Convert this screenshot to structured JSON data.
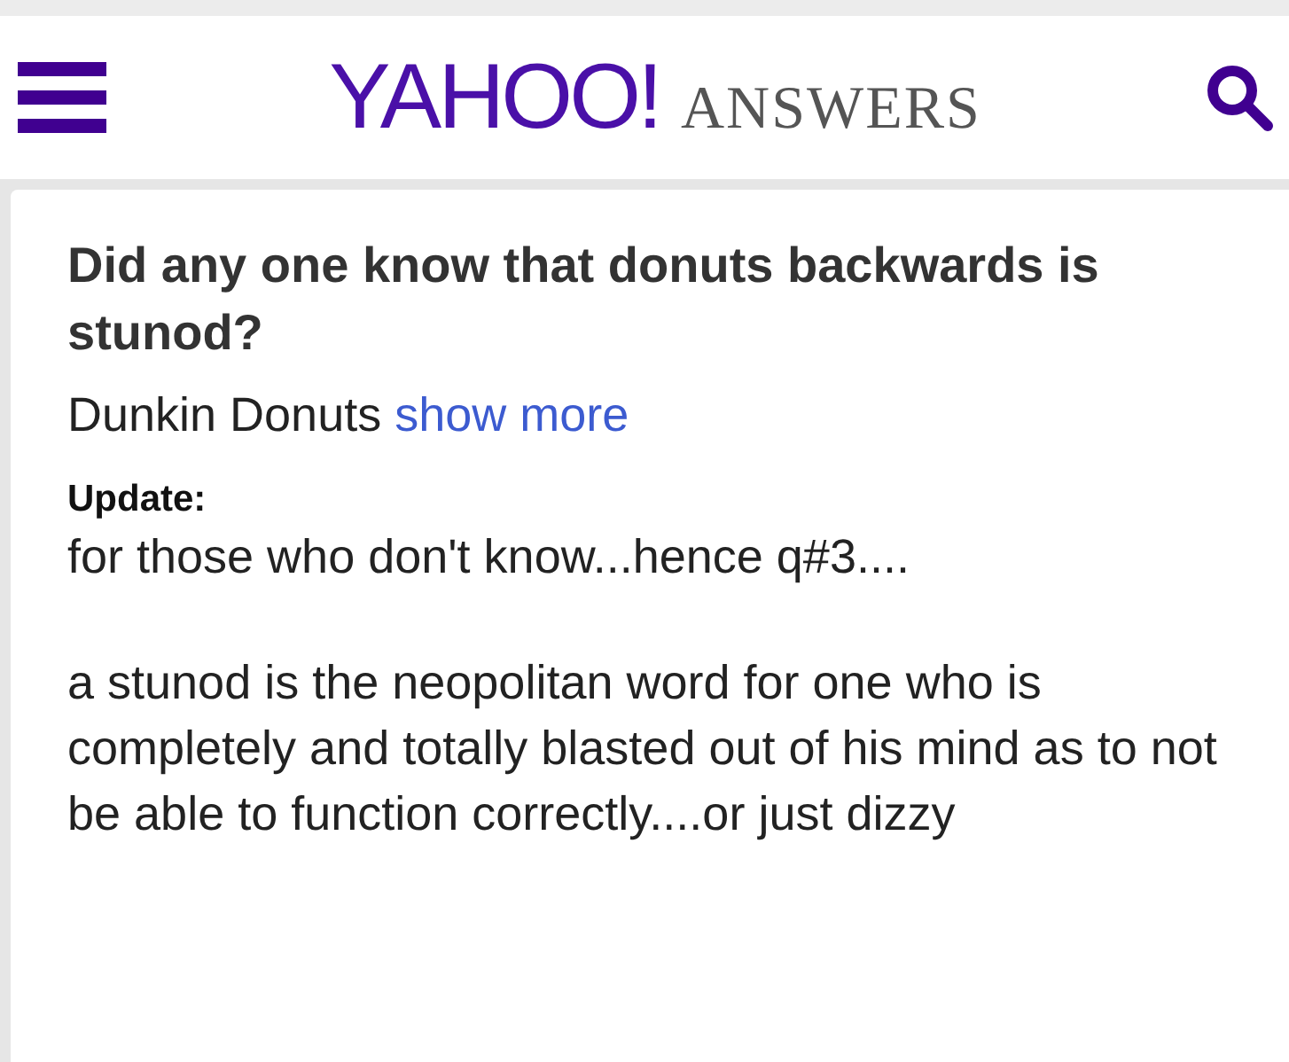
{
  "header": {
    "logo": "YAHOO!",
    "section": "ANSWERS"
  },
  "question": {
    "title": "Did any one know that donuts backwards is stunod?",
    "details": "Dunkin Donuts",
    "show_more": "show more",
    "update_label": "Update:",
    "update_paragraphs": [
      "for those who don't know...hence q#3....",
      "a stunod is the neopolitan word for one who is completely and totally blasted out of his mind as to not be able to function correctly....or just dizzy"
    ]
  }
}
